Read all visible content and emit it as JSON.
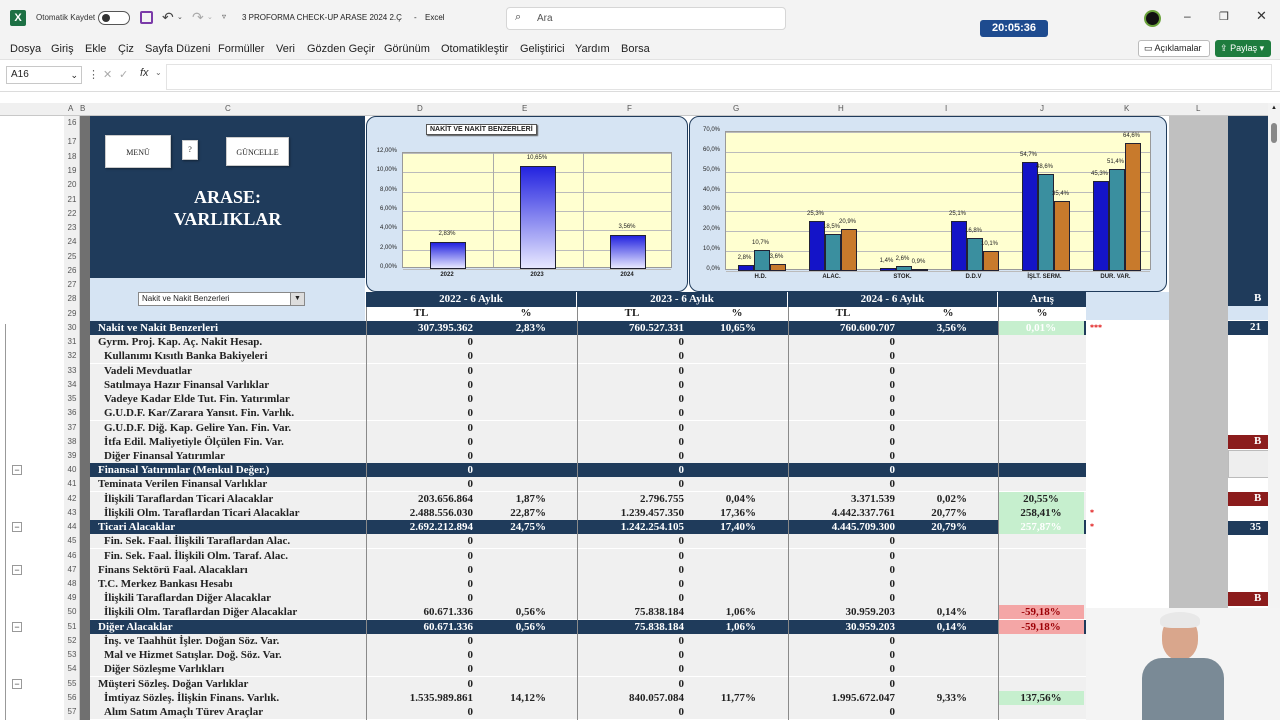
{
  "titlebar": {
    "autosave_label": "Otomatik Kaydet",
    "file_title": "3 PROFORMA CHECK-UP ARASE 2024 2.Ç",
    "app_name": "Excel",
    "search_placeholder": "Ara",
    "clock": "20:05:36"
  },
  "menu": [
    "Dosya",
    "Giriş",
    "Ekle",
    "Çiz",
    "Sayfa Düzeni",
    "Formüller",
    "Veri",
    "Gözden Geçir",
    "Görünüm",
    "Otomatikleştir",
    "Geliştirici",
    "Yardım",
    "Borsa"
  ],
  "ribbon_right": {
    "comments_label": "Açıklamalar",
    "share_label": "Paylaş"
  },
  "formula_bar": {
    "name_box": "A16",
    "fx": "fx"
  },
  "column_headers": [
    "A",
    "B",
    "C",
    "D",
    "E",
    "F",
    "G",
    "H",
    "I",
    "J",
    "K",
    "L"
  ],
  "row_numbers": [
    "16",
    "17",
    "18",
    "19",
    "20",
    "21",
    "22",
    "23",
    "24",
    "25",
    "26",
    "27",
    "28",
    "29",
    "30",
    "31",
    "32",
    "33",
    "34",
    "35",
    "36",
    "37",
    "38",
    "39",
    "40",
    "41",
    "42",
    "43",
    "44",
    "45",
    "46",
    "47",
    "48",
    "49",
    "50",
    "51",
    "52",
    "53",
    "54",
    "55",
    "56",
    "57"
  ],
  "panel": {
    "menu_button": "MENÜ",
    "help_button": "?",
    "update_button": "GÜNCELLE",
    "title_line1": "ARASE:",
    "title_line2": "VARLIKLAR",
    "dropdown_value": "Nakit ve Nakit Benzerleri"
  },
  "chart_data": [
    {
      "type": "bar",
      "title": "NAKİT VE NAKİT BENZERLERİ",
      "categories": [
        "2022",
        "2023",
        "2024"
      ],
      "values": [
        2.83,
        10.65,
        3.56
      ],
      "data_labels": [
        "2,83%",
        "10,65%",
        "3,56%"
      ],
      "ylim": [
        0,
        12
      ],
      "yticks": [
        "0,00%",
        "2,00%",
        "4,00%",
        "6,00%",
        "8,00%",
        "10,00%",
        "12,00%"
      ],
      "grid": true,
      "bar_color": "#2323e0"
    },
    {
      "type": "bar",
      "categories": [
        "H.D.",
        "ALAC.",
        "STOK.",
        "D.D.V",
        "İŞLT. SERM.",
        "DUR. VAR."
      ],
      "series": [
        {
          "values": [
            2.8,
            25.3,
            1.4,
            25.1,
            54.7,
            45.3
          ],
          "labels": [
            "2,8%",
            "25,3%",
            "1,4%",
            "25,1%",
            "54,7%",
            "45,3%"
          ],
          "color": "#1414c8"
        },
        {
          "values": [
            10.7,
            18.5,
            2.6,
            16.8,
            48.6,
            51.4
          ],
          "labels": [
            "10,7%",
            "18,5%",
            "2,6%",
            "16,8%",
            "48,6%",
            "51,4%"
          ],
          "color": "#3a8f9f"
        },
        {
          "values": [
            3.6,
            20.9,
            0.9,
            10.1,
            35.4,
            64.6
          ],
          "labels": [
            "3,6%",
            "20,9%",
            "0,9%",
            "10,1%",
            "35,4%",
            "64,6%"
          ],
          "color": "#c87a2c"
        }
      ],
      "ylim": [
        0,
        70
      ],
      "yticks": [
        "0,0%",
        "10,0%",
        "20,0%",
        "30,0%",
        "40,0%",
        "50,0%",
        "60,0%",
        "70,0%"
      ],
      "grid": true
    }
  ],
  "table": {
    "period_headers": [
      "2022 - 6 Aylık",
      "2023 - 6 Aylık",
      "2024 - 6 Aylık",
      "Artış"
    ],
    "sub_headers": [
      "TL",
      "%",
      "TL",
      "%",
      "TL",
      "%",
      "%"
    ],
    "rows": [
      {
        "label": "Nakit ve Nakit Benzerleri",
        "v22": "307.395.362",
        "p22": "2,83%",
        "v23": "760.527.331",
        "p23": "10,65%",
        "v24": "760.600.707",
        "p24": "3,56%",
        "art": "0,01%",
        "type": "total",
        "art_style": "green",
        "mark": "***"
      },
      {
        "label": "Gyrm. Proj. Kap. Aç. Nakit Hesap.",
        "v22": "0",
        "p22": "",
        "v23": "0",
        "p23": "",
        "v24": "0",
        "p24": "",
        "art": "",
        "type": "item"
      },
      {
        "label": "Kullanımı Kısıtlı Banka Bakiyeleri",
        "v22": "0",
        "p22": "",
        "v23": "0",
        "p23": "",
        "v24": "0",
        "p24": "",
        "art": "",
        "type": "item"
      },
      {
        "label": "Vadeli Mevduatlar",
        "v22": "0",
        "p22": "",
        "v23": "0",
        "p23": "",
        "v24": "0",
        "p24": "",
        "art": "",
        "type": "item"
      },
      {
        "label": "Satılmaya Hazır Finansal Varlıklar",
        "v22": "0",
        "p22": "",
        "v23": "0",
        "p23": "",
        "v24": "0",
        "p24": "",
        "art": "",
        "type": "item"
      },
      {
        "label": "Vadeye Kadar Elde Tut. Fin. Yatırımlar",
        "v22": "0",
        "p22": "",
        "v23": "0",
        "p23": "",
        "v24": "0",
        "p24": "",
        "art": "",
        "type": "item"
      },
      {
        "label": "G.U.D.F. Kar/Zarara Yansıt. Fin. Varlık.",
        "v22": "0",
        "p22": "",
        "v23": "0",
        "p23": "",
        "v24": "0",
        "p24": "",
        "art": "",
        "type": "item"
      },
      {
        "label": "G.U.D.F. Diğ. Kap. Gelire Yan. Fin. Var.",
        "v22": "0",
        "p22": "",
        "v23": "0",
        "p23": "",
        "v24": "0",
        "p24": "",
        "art": "",
        "type": "item"
      },
      {
        "label": "İtfa Edil. Maliyetiyle Ölçülen Fin. Var.",
        "v22": "0",
        "p22": "",
        "v23": "0",
        "p23": "",
        "v24": "0",
        "p24": "",
        "art": "",
        "type": "item"
      },
      {
        "label": "Diğer Finansal Yatırımlar",
        "v22": "0",
        "p22": "",
        "v23": "0",
        "p23": "",
        "v24": "0",
        "p24": "",
        "art": "",
        "type": "item"
      },
      {
        "label": "Finansal Yatırımlar (Menkul Değer.)",
        "v22": "0",
        "p22": "",
        "v23": "0",
        "p23": "",
        "v24": "0",
        "p24": "",
        "art": "",
        "type": "total"
      },
      {
        "label": "Teminata Verilen Finansal Varlıklar",
        "v22": "0",
        "p22": "",
        "v23": "0",
        "p23": "",
        "v24": "0",
        "p24": "",
        "art": "",
        "type": "item"
      },
      {
        "label": "İlişkili Taraflardan Ticari Alacaklar",
        "v22": "203.656.864",
        "p22": "1,87%",
        "v23": "2.796.755",
        "p23": "0,04%",
        "v24": "3.371.539",
        "p24": "0,02%",
        "art": "20,55%",
        "type": "item",
        "art_style": "green"
      },
      {
        "label": "İlişkili Olm. Taraflardan Ticari Alacaklar",
        "v22": "2.488.556.030",
        "p22": "22,87%",
        "v23": "1.239.457.350",
        "p23": "17,36%",
        "v24": "4.442.337.761",
        "p24": "20,77%",
        "art": "258,41%",
        "type": "item",
        "art_style": "green",
        "mark": "*"
      },
      {
        "label": "Ticari Alacaklar",
        "v22": "2.692.212.894",
        "p22": "24,75%",
        "v23": "1.242.254.105",
        "p23": "17,40%",
        "v24": "4.445.709.300",
        "p24": "20,79%",
        "art": "257,87%",
        "type": "total",
        "art_style": "green",
        "mark": "*"
      },
      {
        "label": "Fin. Sek. Faal. İlişkili Taraflardan Alac.",
        "v22": "0",
        "p22": "",
        "v23": "0",
        "p23": "",
        "v24": "0",
        "p24": "",
        "art": "",
        "type": "item"
      },
      {
        "label": "Fin. Sek. Faal. İlişkili Olm. Taraf. Alac.",
        "v22": "0",
        "p22": "",
        "v23": "0",
        "p23": "",
        "v24": "0",
        "p24": "",
        "art": "",
        "type": "item"
      },
      {
        "label": "Finans Sektörü Faal. Alacakları",
        "v22": "0",
        "p22": "",
        "v23": "0",
        "p23": "",
        "v24": "0",
        "p24": "",
        "art": "",
        "type": "item"
      },
      {
        "label": "T.C. Merkez Bankası Hesabı",
        "v22": "0",
        "p22": "",
        "v23": "0",
        "p23": "",
        "v24": "0",
        "p24": "",
        "art": "",
        "type": "item"
      },
      {
        "label": "İlişkili Taraflardan Diğer Alacaklar",
        "v22": "0",
        "p22": "",
        "v23": "0",
        "p23": "",
        "v24": "0",
        "p24": "",
        "art": "",
        "type": "item"
      },
      {
        "label": "İlişkili Olm. Taraflardan Diğer Alacaklar",
        "v22": "60.671.336",
        "p22": "0,56%",
        "v23": "75.838.184",
        "p23": "1,06%",
        "v24": "30.959.203",
        "p24": "0,14%",
        "art": "-59,18%",
        "type": "item",
        "art_style": "red"
      },
      {
        "label": "Diğer Alacaklar",
        "v22": "60.671.336",
        "p22": "0,56%",
        "v23": "75.838.184",
        "p23": "1,06%",
        "v24": "30.959.203",
        "p24": "0,14%",
        "art": "-59,18%",
        "type": "total",
        "art_style": "red"
      },
      {
        "label": "İnş. ve Taahhüt İşler. Doğan Söz. Var.",
        "v22": "0",
        "p22": "",
        "v23": "0",
        "p23": "",
        "v24": "0",
        "p24": "",
        "art": "",
        "type": "item"
      },
      {
        "label": "Mal ve Hizmet Satışlar. Doğ. Söz. Var.",
        "v22": "0",
        "p22": "",
        "v23": "0",
        "p23": "",
        "v24": "0",
        "p24": "",
        "art": "",
        "type": "item"
      },
      {
        "label": "Diğer Sözleşme Varlıkları",
        "v22": "0",
        "p22": "",
        "v23": "0",
        "p23": "",
        "v24": "0",
        "p24": "",
        "art": "",
        "type": "item"
      },
      {
        "label": "Müşteri Sözleş. Doğan Varlıklar",
        "v22": "0",
        "p22": "",
        "v23": "0",
        "p23": "",
        "v24": "0",
        "p24": "",
        "art": "",
        "type": "item"
      },
      {
        "label": "İmtiyaz Sözleş. İlişkin Finans. Varlık.",
        "v22": "1.535.989.861",
        "p22": "14,12%",
        "v23": "840.057.084",
        "p23": "11,77%",
        "v24": "1.995.672.047",
        "p24": "9,33%",
        "art": "137,56%",
        "type": "item",
        "art_style": "green"
      },
      {
        "label": "Alım Satım Amaçlı Türev Araçlar",
        "v22": "0",
        "p22": "",
        "v23": "0",
        "p23": "",
        "v24": "0",
        "p24": "",
        "art": "",
        "type": "item"
      }
    ]
  },
  "right_partial": {
    "r28": "B",
    "r30": "21",
    "r38": "B",
    "r42": "B",
    "r44": "35",
    "r49": "B"
  }
}
